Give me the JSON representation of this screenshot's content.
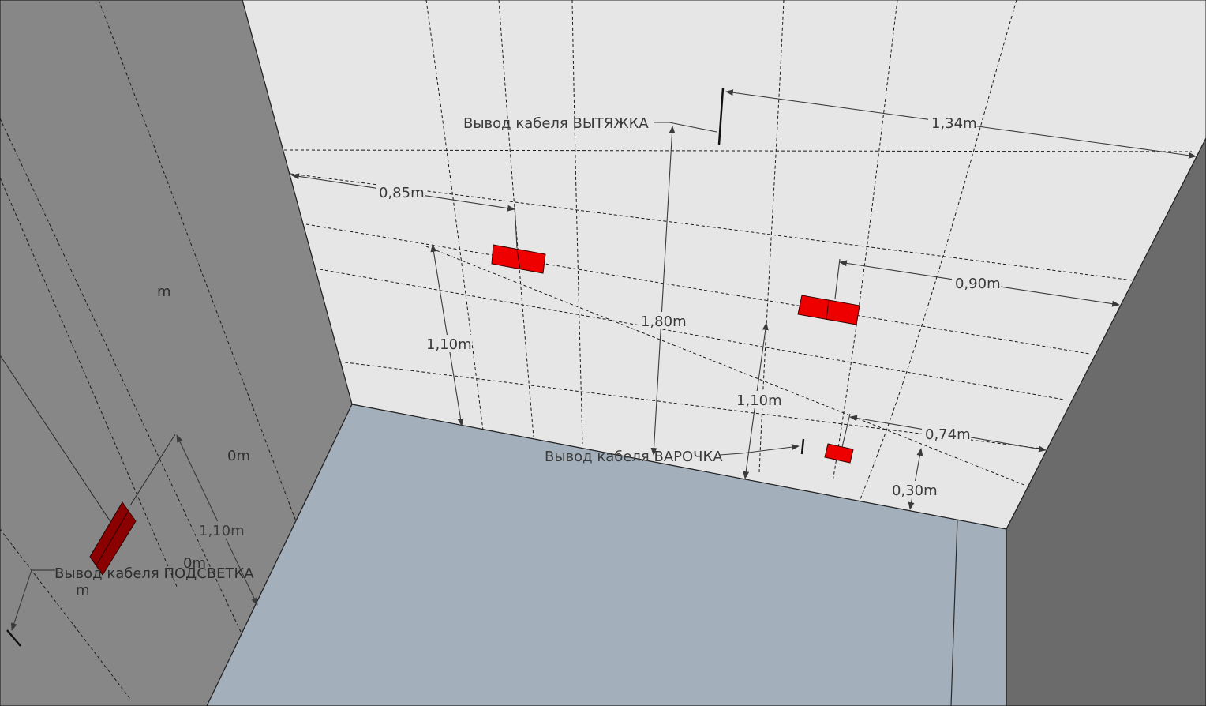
{
  "colors": {
    "back_wall": "#e6e6e6",
    "left_wall": "#878787",
    "right_wall": "#6b6b6b",
    "floor": "#a3b0bc",
    "socket_front": "#ee0000",
    "socket_side": "#8b0000",
    "line": "#2a2a2a"
  },
  "labels": {
    "hood_cable": "Вывод кабеля ВЫТЯЖКА",
    "hob_cable": "Вывод кабеля ВАРОЧКА",
    "backlight_cable": "Вывод кабеля ПОДСВЕТКА"
  },
  "dimensions": {
    "hood_offset": "1,34m",
    "left_socket_offset": "0,85m",
    "right_socket_offset": "0,90m",
    "hood_height": "1,80m",
    "left_socket_height": "1,10m",
    "right_socket_height": "1,10m",
    "small_socket_offset": "0,74m",
    "small_socket_height": "0,30m",
    "side_socket_height": "1,10m"
  },
  "side_wall_fragments": {
    "fragment_1": "m",
    "fragment_2": "0m",
    "fragment_3": "0m",
    "fragment_4": "m"
  }
}
